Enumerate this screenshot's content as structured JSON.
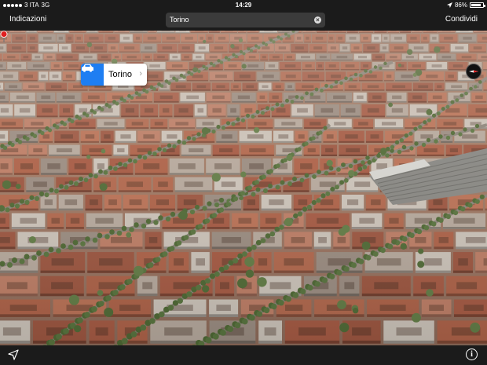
{
  "status_bar": {
    "carrier": "3 ITA",
    "network": "3G",
    "time": "14:29",
    "battery": "86%",
    "battery_level": 0.86
  },
  "nav": {
    "left_button": "Indicazioni",
    "search_value": "Torino",
    "right_button": "Condividi"
  },
  "map": {
    "callout_title": "Torino",
    "callout_icon": "car-icon",
    "pin_icon": "map-pin-icon",
    "compass_icon": "compass-icon"
  },
  "toolbar": {
    "locate_icon": "location-arrow-icon",
    "info_label": "i"
  },
  "colors": {
    "bars": "#1b1b1b",
    "accent": "#1e7ef2",
    "pin": "#e02020",
    "roofs": "#b0644a",
    "trees": "#4f6a35"
  }
}
